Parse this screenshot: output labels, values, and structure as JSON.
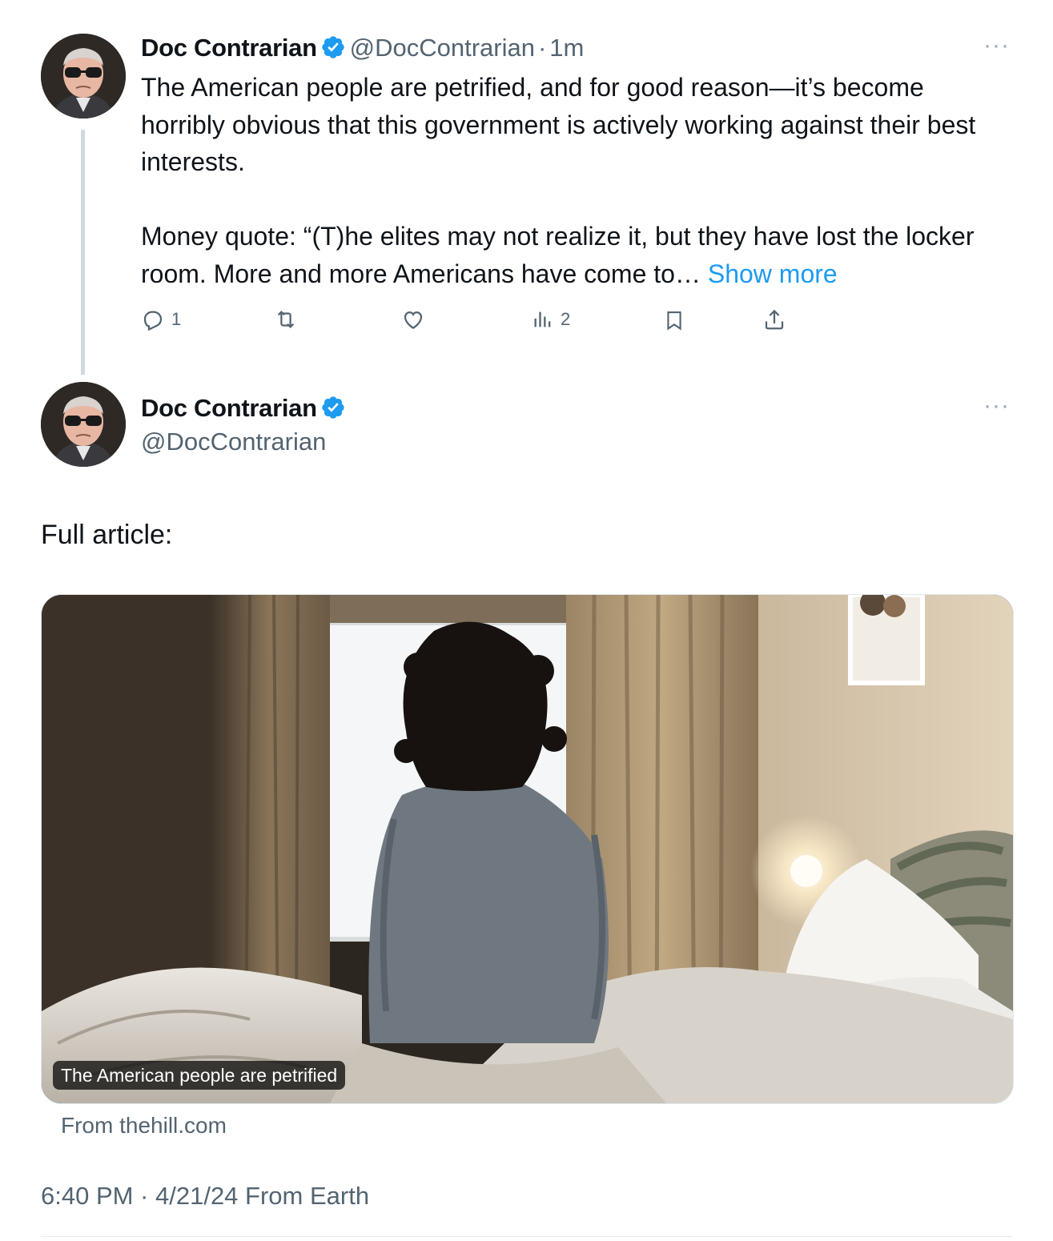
{
  "tweet1": {
    "author_name": "Doc Contrarian",
    "handle": "@DocContrarian",
    "separator": "·",
    "time": "1m",
    "text": "The American people are petrified, and for good reason—it’s become horribly obvious that this government is actively working against their best interests.\n\nMoney quote: “(T)he elites may not realize it, but they have lost the locker room. More and more Americans have come to… ",
    "show_more": "Show more",
    "more_menu": "···",
    "actions": {
      "reply": {
        "icon": "reply-icon",
        "count": "1"
      },
      "retweet": {
        "icon": "retweet-icon",
        "count": ""
      },
      "like": {
        "icon": "heart-icon",
        "count": ""
      },
      "views": {
        "icon": "views-icon",
        "count": "2"
      },
      "bookmark": {
        "icon": "bookmark-icon",
        "count": ""
      },
      "share": {
        "icon": "share-icon",
        "count": ""
      }
    }
  },
  "tweet2": {
    "author_name": "Doc Contrarian",
    "handle": "@DocContrarian",
    "more_menu": "···",
    "text": "Full article:",
    "card": {
      "image_subject": "woman-sitting-on-bed-facing-window",
      "caption": "The American people are petrified",
      "source": "From thehill.com"
    },
    "timestamp": "6:40 PM · 4/21/24 From Earth"
  },
  "colors": {
    "text_primary": "#0f1419",
    "text_secondary": "#536471",
    "link_blue": "#1d9bf0",
    "thread_line": "#cfd9de"
  }
}
